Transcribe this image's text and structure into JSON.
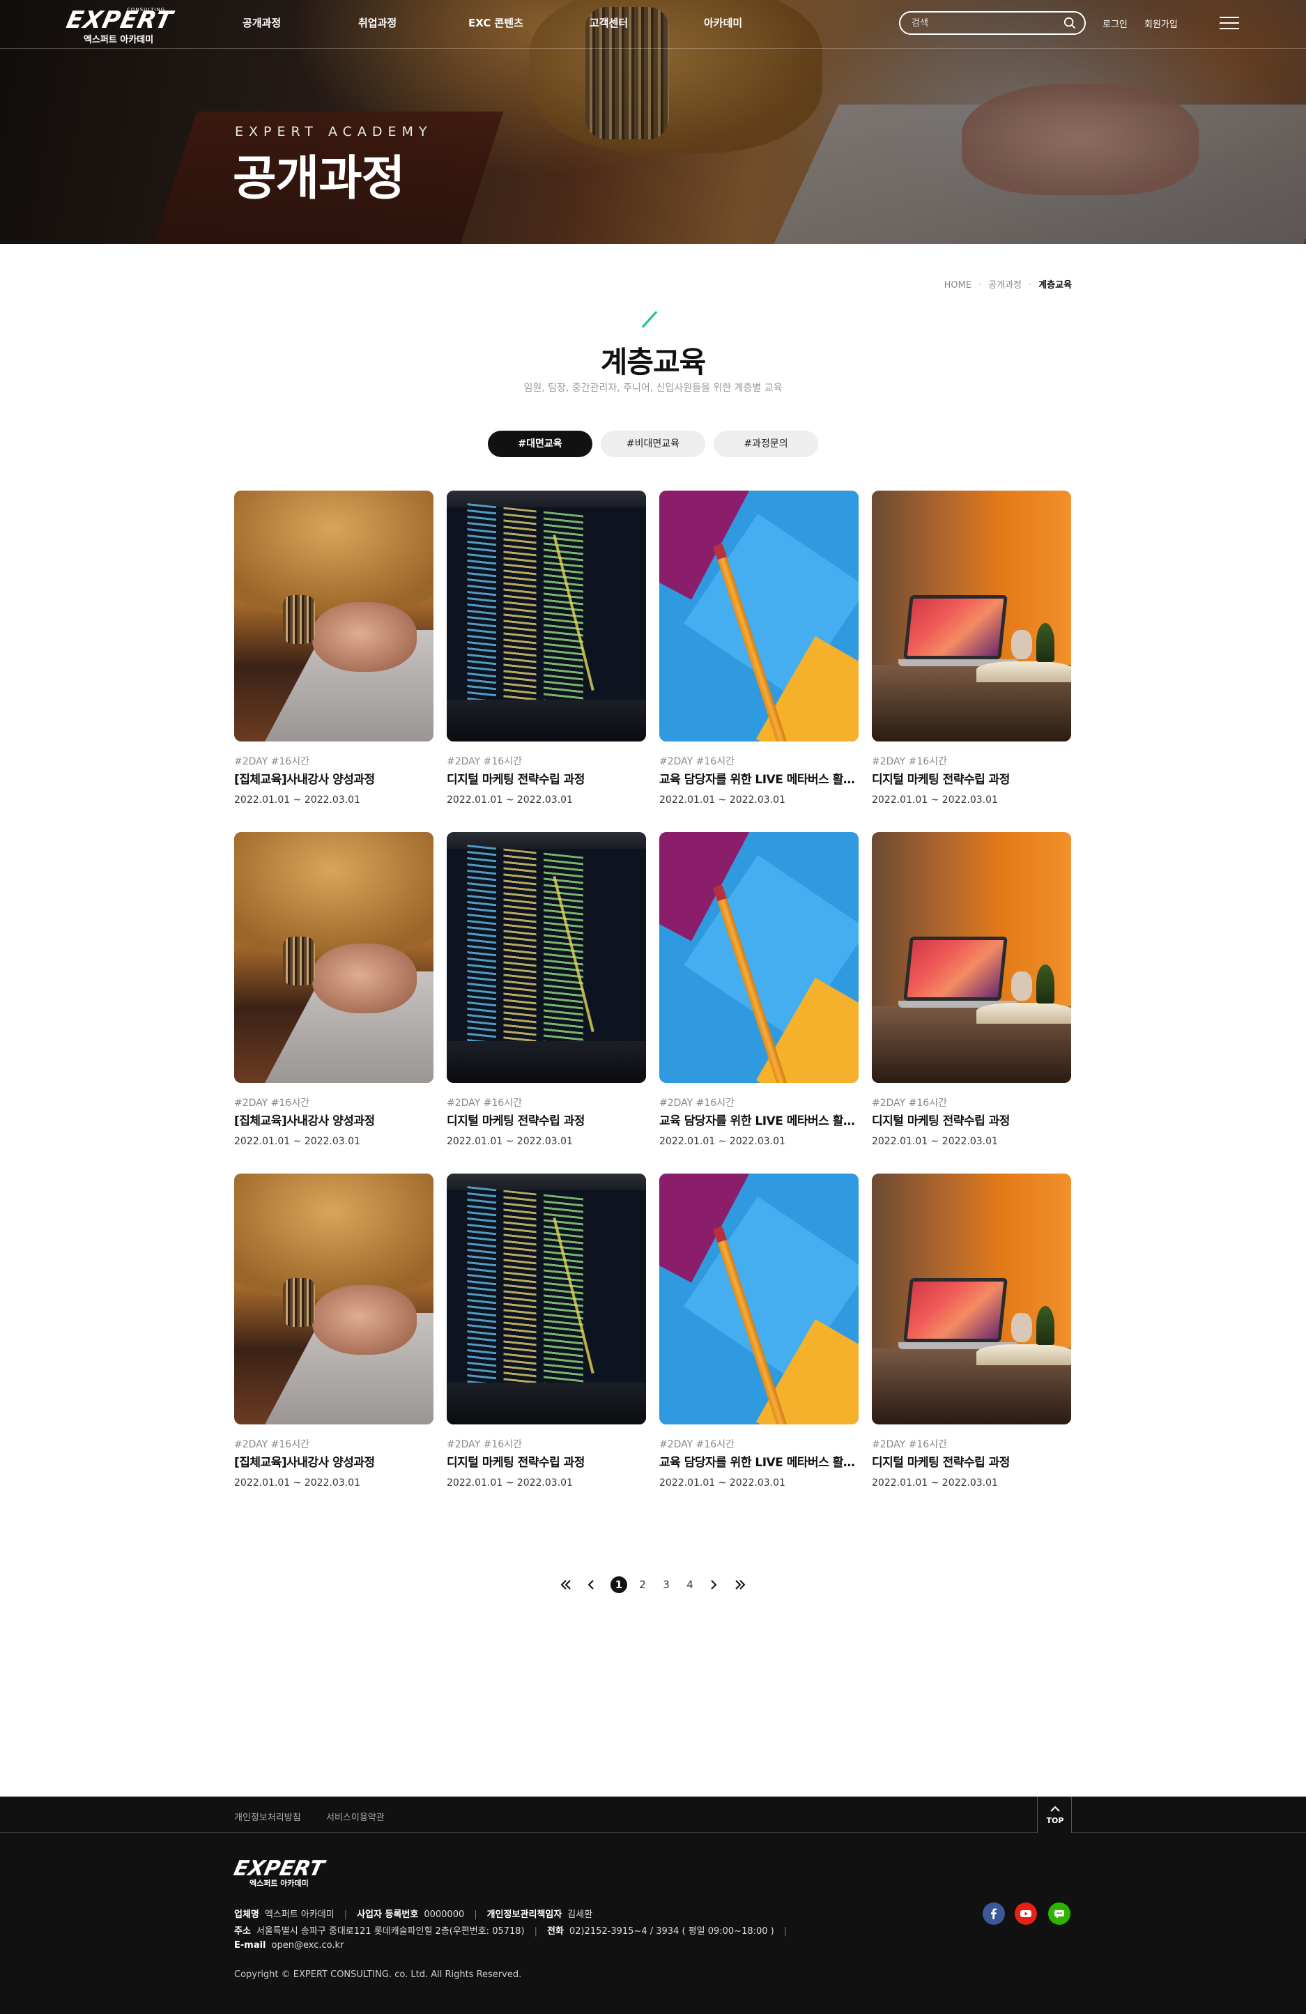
{
  "header": {
    "logo": {
      "mark": "EXPERT",
      "tagline": "CONSULTING",
      "sub": "엑스퍼트 아카데미"
    },
    "nav": [
      "공개과정",
      "취업과정",
      "EXC 콘텐츠",
      "고객센터",
      "아카데미"
    ],
    "search": {
      "placeholder": "검색"
    },
    "login": "로그인",
    "signup": "회원가입"
  },
  "hero": {
    "eyebrow": "EXPERT ACADEMY",
    "title": "공개과정"
  },
  "breadcrumb": [
    "HOME",
    "공개과정",
    "계층교육"
  ],
  "section": {
    "title": "계층교육",
    "subtitle": "임원, 팀장, 중간관리자, 주니어, 신입사원들을 위한 계층별 교육",
    "accent_color": "#18c08a"
  },
  "tabs": [
    {
      "label": "#대면교육",
      "active": true
    },
    {
      "label": "#비대면교육",
      "active": false
    },
    {
      "label": "#과정문의",
      "active": false
    }
  ],
  "courses": [
    {
      "image": "laptop-hands",
      "meta": "#2DAY #16시간",
      "title": "[집체교육]사내강사 양성과정",
      "date": "2022.01.01 ~ 2022.03.01"
    },
    {
      "image": "code-screen",
      "meta": "#2DAY #16시간",
      "title": "디지털 마케팅 전략수립 과정",
      "date": "2022.01.01 ~ 2022.03.01"
    },
    {
      "image": "pencil-paper",
      "meta": "#2DAY #16시간",
      "title": "교육 담당자를 위한 LIVE 메타버스 활용법",
      "date": "2022.01.01 ~ 2022.03.01"
    },
    {
      "image": "macbook-desk",
      "meta": "#2DAY #16시간",
      "title": "디지털 마케팅 전략수립 과정",
      "date": "2022.01.01 ~ 2022.03.01"
    },
    {
      "image": "laptop-hands",
      "meta": "#2DAY #16시간",
      "title": "[집체교육]사내강사 양성과정",
      "date": "2022.01.01 ~ 2022.03.01"
    },
    {
      "image": "code-screen",
      "meta": "#2DAY #16시간",
      "title": "디지털 마케팅 전략수립 과정",
      "date": "2022.01.01 ~ 2022.03.01"
    },
    {
      "image": "pencil-paper",
      "meta": "#2DAY #16시간",
      "title": "교육 담당자를 위한 LIVE 메타버스 활용법",
      "date": "2022.01.01 ~ 2022.03.01"
    },
    {
      "image": "macbook-desk",
      "meta": "#2DAY #16시간",
      "title": "디지털 마케팅 전략수립 과정",
      "date": "2022.01.01 ~ 2022.03.01"
    },
    {
      "image": "laptop-hands",
      "meta": "#2DAY #16시간",
      "title": "[집체교육]사내강사 양성과정",
      "date": "2022.01.01 ~ 2022.03.01"
    },
    {
      "image": "code-screen",
      "meta": "#2DAY #16시간",
      "title": "디지털 마케팅 전략수립 과정",
      "date": "2022.01.01 ~ 2022.03.01"
    },
    {
      "image": "pencil-paper",
      "meta": "#2DAY #16시간",
      "title": "교육 담당자를 위한 LIVE 메타버스 활용법",
      "date": "2022.01.01 ~ 2022.03.01"
    },
    {
      "image": "macbook-desk",
      "meta": "#2DAY #16시간",
      "title": "디지털 마케팅 전략수립 과정",
      "date": "2022.01.01 ~ 2022.03.01"
    }
  ],
  "pagination": {
    "pages": [
      "1",
      "2",
      "3",
      "4"
    ],
    "current": "1"
  },
  "footer": {
    "links": [
      "개인정보처리방침",
      "서비스이용약관"
    ],
    "top_label": "TOP",
    "logo": {
      "mark": "EXPERT",
      "sub": "엑스퍼트 아카데미"
    },
    "company_label": "업체명",
    "company": "엑스퍼트 아카데미",
    "biz_label": "사업자 등록번호",
    "biz": "0000000",
    "privacy_label": "개인정보관리책임자",
    "privacy": "김세환",
    "address_label": "주소",
    "address": "서울특별시 송파구 중대로121 롯데캐슬파인힐 2층(우편번호: 05718)",
    "phone_label": "전화",
    "phone": "02)2152-3915~4 / 3934 ( 평일 09:00~18:00 )",
    "email_label": "E-mail",
    "email": "open@exc.co.kr",
    "copyright": "Copyright © EXPERT CONSULTING. co. Ltd. All Rights Reserved.",
    "sns": [
      {
        "name": "facebook-icon",
        "color": "#3b5998"
      },
      {
        "name": "youtube-icon",
        "color": "#e62117"
      },
      {
        "name": "kakaotalk-icon",
        "color": "#2db400"
      }
    ]
  }
}
